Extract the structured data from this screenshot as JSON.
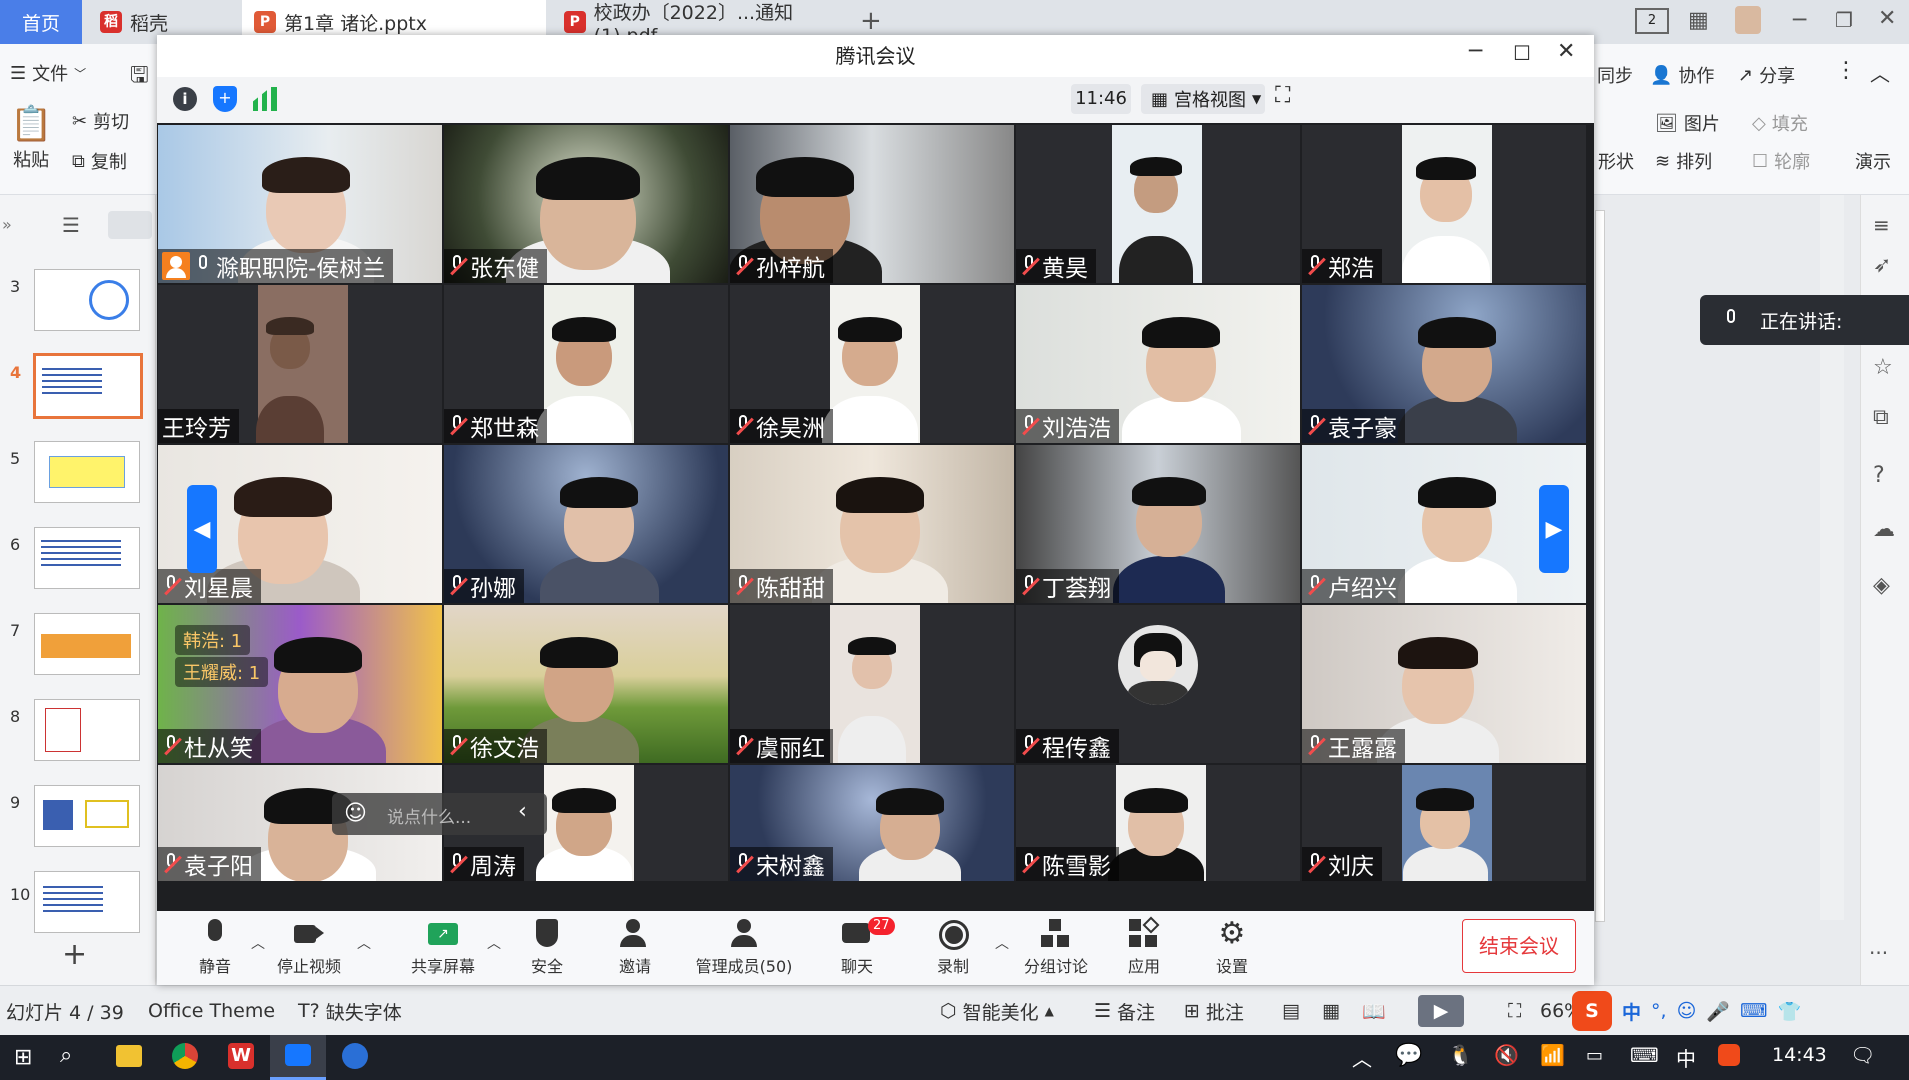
{
  "wps": {
    "tabs": [
      {
        "label": "首页"
      },
      {
        "label": "稻壳"
      },
      {
        "label": "第1章 诸论.pptx"
      },
      {
        "label": "校政办〔2022〕...通知(1).pdf"
      }
    ],
    "toolbar": {
      "file": "文件",
      "paste": "粘贴",
      "cut": "剪切",
      "copy": "复制",
      "sync": "同步",
      "collab": "协作",
      "share": "分享",
      "picture": "图片",
      "fill": "填充",
      "shape": "形状",
      "arrange": "排列",
      "outline": "轮廓",
      "present": "演示"
    },
    "slides": [
      "3",
      "4",
      "5",
      "6",
      "7",
      "8",
      "9",
      "10"
    ],
    "selected_slide": "4",
    "statusbar": {
      "slide_info": "幻灯片 4 / 39",
      "theme": "Office Theme",
      "missing_font": "缺失字体",
      "beautify": "智能美化",
      "notes": "备注",
      "comments": "批注",
      "zoom": "66%"
    }
  },
  "speaking": {
    "label": "正在讲话:"
  },
  "meeting": {
    "title": "腾讯会议",
    "time": "11:46",
    "view_mode": "宫格视图",
    "participants": [
      {
        "name": "滁职职院-侯树兰",
        "muted": false,
        "host": true
      },
      {
        "name": "张东健",
        "muted": true
      },
      {
        "name": "孙梓航",
        "muted": true
      },
      {
        "name": "黄昊",
        "muted": true
      },
      {
        "name": "郑浩",
        "muted": true
      },
      {
        "name": "王玲芳",
        "muted": null
      },
      {
        "name": "郑世森",
        "muted": true
      },
      {
        "name": "徐昊洲",
        "muted": true
      },
      {
        "name": "刘浩浩",
        "muted": true
      },
      {
        "name": "袁子豪",
        "muted": true
      },
      {
        "name": "刘星晨",
        "muted": true
      },
      {
        "name": "孙娜",
        "muted": true
      },
      {
        "name": "陈甜甜",
        "muted": true
      },
      {
        "name": "丁荟翔",
        "muted": true
      },
      {
        "name": "卢绍兴",
        "muted": true
      },
      {
        "name": "杜从笑",
        "muted": true
      },
      {
        "name": "徐文浩",
        "muted": true
      },
      {
        "name": "虞丽红",
        "muted": true
      },
      {
        "name": "程传鑫",
        "muted": true
      },
      {
        "name": "王露露",
        "muted": true
      },
      {
        "name": "袁子阳",
        "muted": true
      },
      {
        "name": "周涛",
        "muted": true
      },
      {
        "name": "宋树鑫",
        "muted": true
      },
      {
        "name": "陈雪影",
        "muted": true
      },
      {
        "name": "刘庆",
        "muted": true
      }
    ],
    "chat_bubbles": [
      {
        "text": "韩浩: 1"
      },
      {
        "text": "王耀威: 1"
      }
    ],
    "chat_placeholder": "说点什么...",
    "toolbar": {
      "mute": "静音",
      "stop_video": "停止视频",
      "share_screen": "共享屏幕",
      "security": "安全",
      "invite": "邀请",
      "manage_members": "管理成员(50)",
      "chat": "聊天",
      "chat_badge": "27",
      "record": "录制",
      "breakout": "分组讨论",
      "apps": "应用",
      "settings": "设置",
      "end_meeting": "结束会议"
    }
  },
  "taskbar": {
    "clock": "14:43",
    "ime": "中"
  },
  "colors": {
    "accent_blue": "#1677ff",
    "end_red": "#e5383b",
    "wps_orange": "#e8743b"
  }
}
